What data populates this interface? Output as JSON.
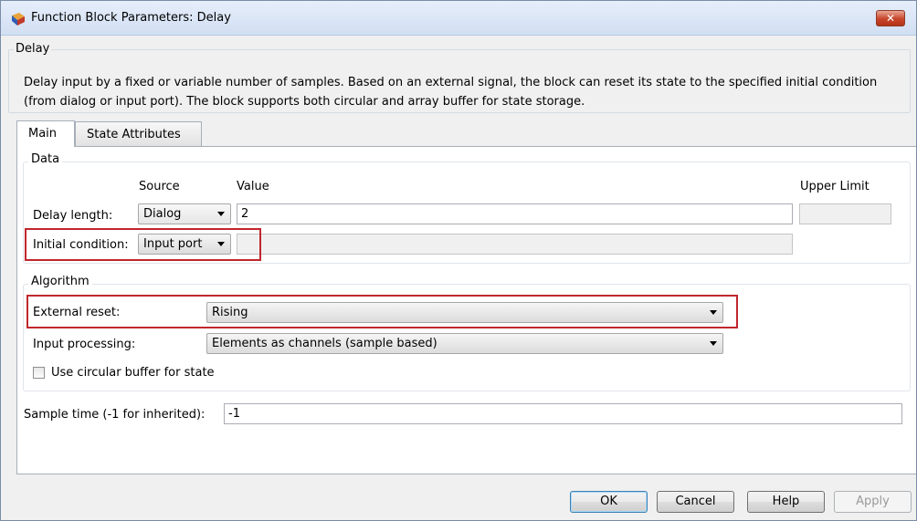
{
  "window": {
    "title": "Function Block Parameters: Delay",
    "close_label": "✕"
  },
  "block": {
    "group_label": "Delay",
    "description": "Delay input by a fixed or variable number of samples. Based on an external signal, the block can reset its state to the specified initial condition (from dialog or input port). The block supports both circular and array buffer for state storage."
  },
  "tabs": [
    {
      "label": "Main",
      "active": true
    },
    {
      "label": "State Attributes",
      "active": false
    }
  ],
  "data_group": {
    "label": "Data",
    "headers": {
      "source": "Source",
      "value": "Value",
      "upper_limit": "Upper Limit"
    },
    "delay_length": {
      "label": "Delay length:",
      "source": "Dialog",
      "value": "2",
      "upper_limit": ""
    },
    "initial_condition": {
      "label": "Initial condition:",
      "source": "Input port",
      "value": ""
    }
  },
  "algorithm_group": {
    "label": "Algorithm",
    "external_reset": {
      "label": "External reset:",
      "value": "Rising"
    },
    "input_processing": {
      "label": "Input processing:",
      "value": "Elements as channels (sample based)"
    },
    "circular_buffer": {
      "label": "Use circular buffer for state",
      "checked": false
    }
  },
  "sample_time": {
    "label": "Sample time (-1 for inherited):",
    "value": "-1"
  },
  "buttons": {
    "ok": "OK",
    "cancel": "Cancel",
    "help": "Help",
    "apply": "Apply"
  },
  "colors": {
    "highlight": "#c0272d",
    "title_bar": "#d1dff3",
    "close_button": "#c8452b"
  }
}
